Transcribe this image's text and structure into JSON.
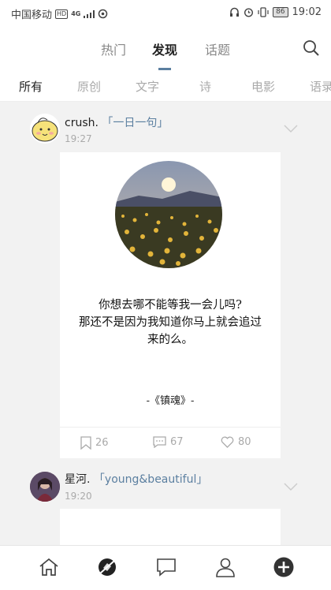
{
  "status_bar": {
    "carrier": "中国移动",
    "hd_badge": "HD",
    "network": "4G",
    "battery": "86",
    "time": "19:02"
  },
  "top_nav": {
    "tabs": [
      {
        "label": "热门",
        "active": false
      },
      {
        "label": "发现",
        "active": true
      },
      {
        "label": "话题",
        "active": false
      }
    ],
    "search_icon": "search-icon"
  },
  "categories": [
    {
      "label": "所有",
      "active": true
    },
    {
      "label": "原创",
      "active": false
    },
    {
      "label": "文字",
      "active": false
    },
    {
      "label": "诗",
      "active": false
    },
    {
      "label": "电影",
      "active": false
    },
    {
      "label": "语录",
      "active": false
    }
  ],
  "posts": [
    {
      "username": "crush.",
      "tag": "「一日一句」",
      "time": "19:27",
      "quote_lines": [
        "你想去哪不能等我一会儿吗?",
        "那还不是因为我知道你马上就会追过",
        "来的么。"
      ],
      "source": "-《镇魂》-",
      "bookmarks": "26",
      "comments": "67",
      "likes": "80"
    },
    {
      "username": "星河.",
      "tag": "「young&beautiful」",
      "time": "19:20"
    }
  ],
  "bottom_bar": [
    "home-icon",
    "discover-icon",
    "message-icon",
    "profile-icon",
    "add-icon"
  ],
  "colors": {
    "accent": "#5b7fa0",
    "muted": "#aaaaaa",
    "background": "#f2f2f2"
  }
}
